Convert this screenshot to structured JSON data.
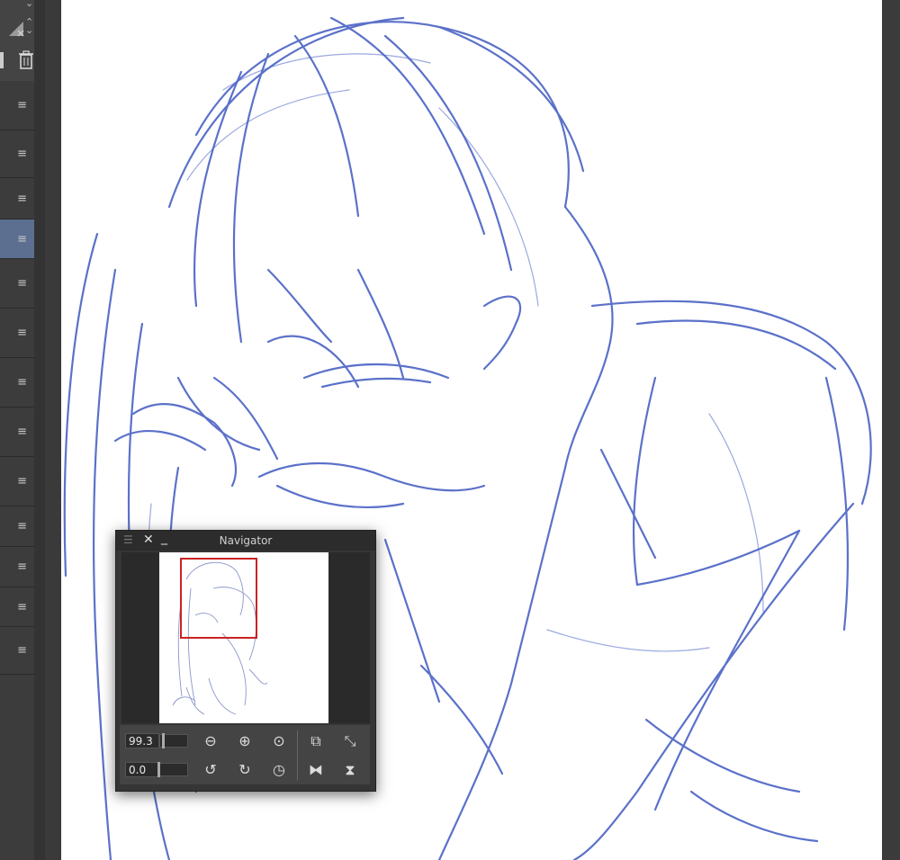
{
  "navigator": {
    "title": "Navigator",
    "zoom_value": "99.3",
    "rotation_value": "0.0"
  },
  "layers": {
    "selected_index": 3,
    "menu_glyph": "≡"
  },
  "colors": {
    "sketch_stroke": "#4a62c4",
    "view_frame": "#cc2222",
    "selected_layer": "#5d6f90"
  }
}
